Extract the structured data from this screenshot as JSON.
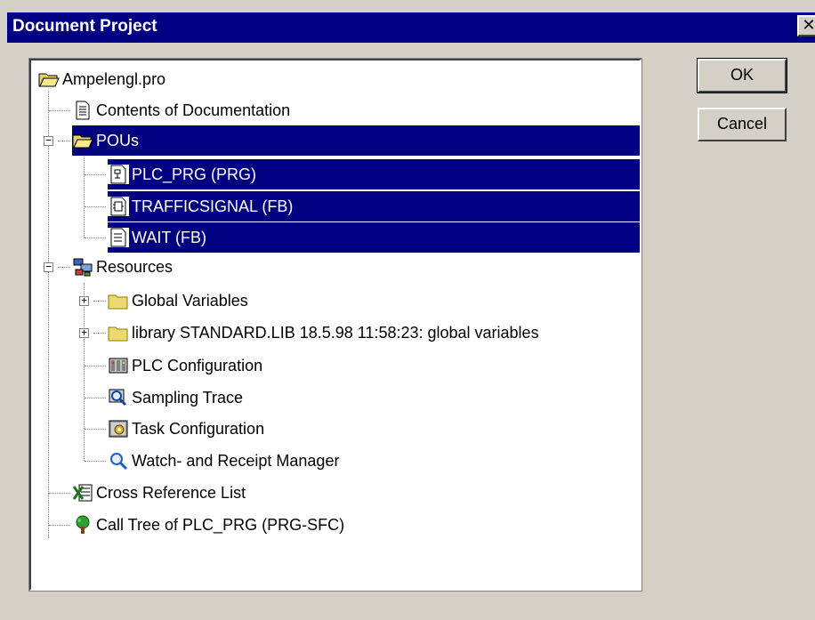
{
  "window": {
    "title": "Document Project",
    "close_glyph": "✕"
  },
  "buttons": {
    "ok": "OK",
    "cancel": "Cancel"
  },
  "tree": {
    "root": "Ampelengl.pro",
    "contents": "Contents of Documentation",
    "pous": "POUs",
    "plc_prg": "PLC_PRG (PRG)",
    "trafficsignal": "TRAFFICSIGNAL (FB)",
    "wait": "WAIT (FB)",
    "resources": "Resources",
    "global_vars": "Global Variables",
    "library": "library STANDARD.LIB 18.5.98 11:58:23: global variables",
    "plc_config": "PLC Configuration",
    "sampling_trace": "Sampling Trace",
    "task_config": "Task Configuration",
    "watch_manager": "Watch- and Receipt Manager",
    "cross_ref": "Cross Reference List",
    "call_tree": "Call Tree of PLC_PRG (PRG-SFC)"
  },
  "colors": {
    "selection": "#000080",
    "face": "#d4d0c8"
  }
}
